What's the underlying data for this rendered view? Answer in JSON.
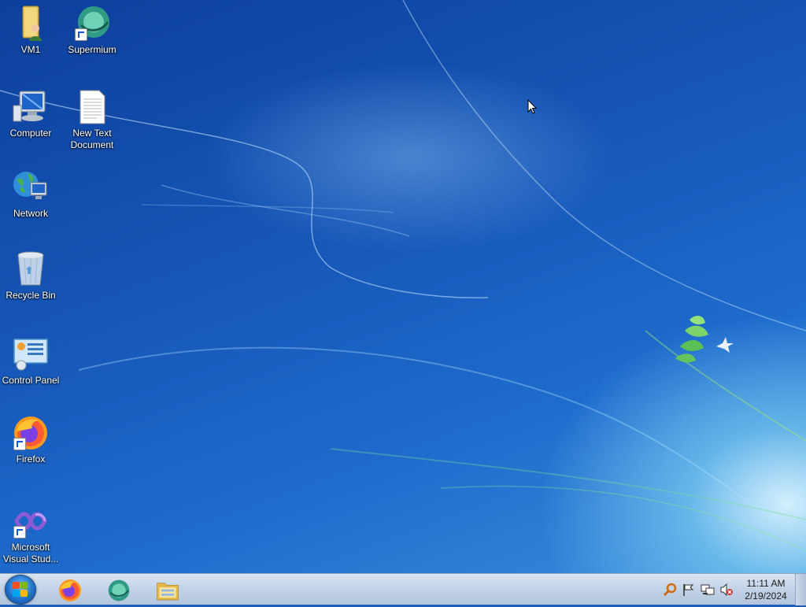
{
  "desktop": {
    "icons": [
      {
        "label": "VM1",
        "icon": "user-folder-icon"
      },
      {
        "label": "Supermium",
        "icon": "supermium-icon",
        "shortcut": true
      },
      {
        "label": "Computer",
        "icon": "computer-icon"
      },
      {
        "label": "New Text Document",
        "icon": "text-document-icon"
      },
      {
        "label": "Network",
        "icon": "network-icon"
      },
      {
        "label": "Recycle Bin",
        "icon": "recycle-bin-icon"
      },
      {
        "label": "Control Panel",
        "icon": "control-panel-icon"
      },
      {
        "label": "Firefox",
        "icon": "firefox-icon",
        "shortcut": true
      },
      {
        "label": "Microsoft Visual Stud...",
        "icon": "visual-studio-icon",
        "shortcut": true
      }
    ]
  },
  "taskbar": {
    "start_icon": "windows-logo-icon",
    "pinned": [
      {
        "name": "Firefox",
        "icon": "firefox-icon"
      },
      {
        "name": "Supermium",
        "icon": "supermium-icon"
      },
      {
        "name": "Windows Explorer",
        "icon": "folder-icon"
      }
    ],
    "tray": [
      {
        "icon": "search-key-icon"
      },
      {
        "icon": "action-center-flag-icon"
      },
      {
        "icon": "network-tray-icon"
      },
      {
        "icon": "volume-muted-icon"
      }
    ],
    "clock": {
      "time": "11:11 AM",
      "date": "2/19/2024"
    }
  },
  "colors": {
    "accent": "#1d5fb8",
    "taskbar": "#c4d4e8"
  }
}
